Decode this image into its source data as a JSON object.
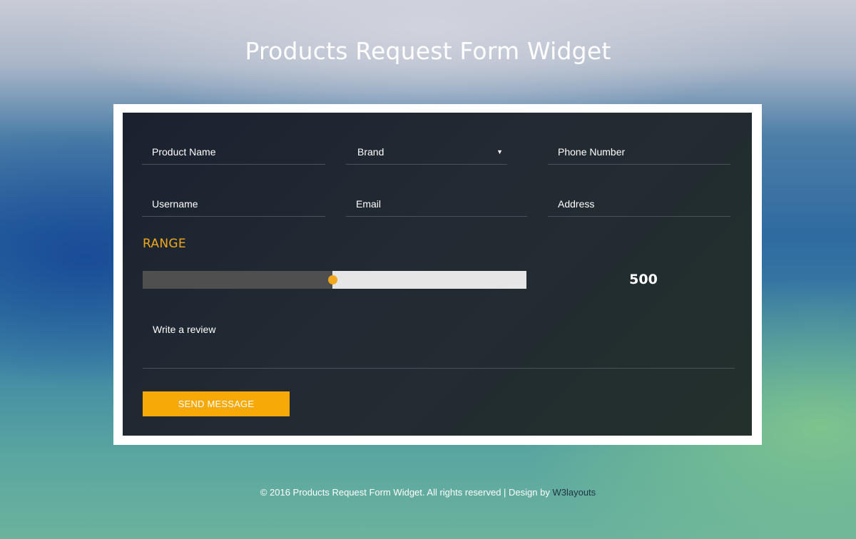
{
  "page": {
    "title": "Products Request Form Widget"
  },
  "form": {
    "product_name_placeholder": "Product Name",
    "brand_select_value": "Brand",
    "phone_placeholder": "Phone Number",
    "username_placeholder": "Username",
    "email_placeholder": "Email",
    "address_placeholder": "Address",
    "range_label": "RANGE",
    "range_value": "500",
    "range_fraction": 0.495,
    "review_placeholder": "Write a review",
    "send_label": "SEND MESSAGE"
  },
  "footer": {
    "text": "© 2016 Products Request Form Widget. All rights reserved | Design by ",
    "link_label": "W3layouts"
  },
  "colors": {
    "accent": "#f7a907",
    "card_bg": "#1f2731",
    "frame": "#ffffff"
  }
}
